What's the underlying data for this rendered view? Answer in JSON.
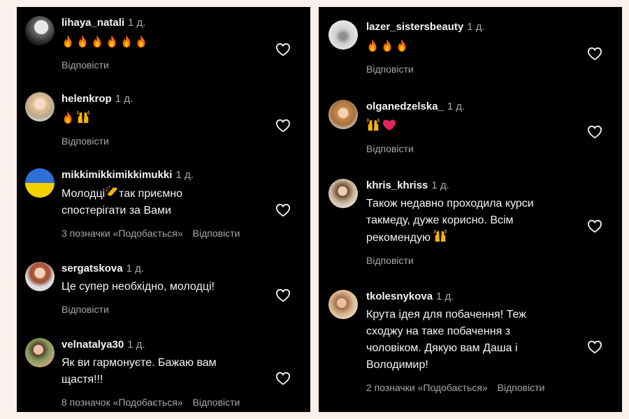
{
  "left_panel": {
    "comments": [
      {
        "username": "lihaya_natali",
        "time": "1 д.",
        "text": "",
        "emoji": [
          "fire",
          "fire",
          "fire",
          "fire",
          "fire",
          "fire"
        ],
        "likes": "",
        "reply": "Відповісти"
      },
      {
        "username": "helenkrop",
        "time": "1 д.",
        "text": "",
        "emoji": [
          "fire",
          "raised-hands"
        ],
        "likes": "",
        "reply": "Відповісти"
      },
      {
        "username": "mikkimikkimikkimukki",
        "time": "1 д.",
        "text_line1": "Молодці",
        "text_line1_rest": "так приємно",
        "text_line2": "спостерігати за Вами",
        "emoji": [
          "clap"
        ],
        "likes": "3 позначки «Подобається»",
        "reply": "Відповісти"
      },
      {
        "username": "sergatskova",
        "time": "1 д.",
        "text": "Це супер необхідно, молодці!",
        "likes": "",
        "reply": "Відповісти"
      },
      {
        "username": "velnatalya30",
        "time": "1 д.",
        "text_line1": "Як ви гармонуєте. Бажаю вам",
        "text_line2": "щастя!!!",
        "likes": "8 позначок «Подобається»",
        "reply": "Відповісти"
      }
    ]
  },
  "right_panel": {
    "comments": [
      {
        "username": "lazer_sistersbeauty",
        "time": "1 д.",
        "emoji": [
          "fire",
          "fire",
          "fire"
        ],
        "likes": "",
        "reply": "Відповісти"
      },
      {
        "username": "olganedzelska_",
        "time": "1 д.",
        "emoji": [
          "raised-hands",
          "red-heart"
        ],
        "likes": "",
        "reply": "Відповісти"
      },
      {
        "username": "khris_khriss",
        "time": "1 д.",
        "text_line1": "Також недавно проходила курси",
        "text_line2": "такмеду, дуже корисно. Всім",
        "text_line3": "рекомендую",
        "emoji": [
          "raised-hands"
        ],
        "likes": "",
        "reply": "Відповісти"
      },
      {
        "username": "tkolesnykova",
        "time": "1 д.",
        "text_line1": "Крута ідея для побачення! Теж",
        "text_line2": "сходжу на таке побачення з",
        "text_line3": "чоловіком. Дякую вам Даша і",
        "text_line4": "Володимир!",
        "likes": "2 позначки «Подобається»",
        "reply": "Відповісти"
      }
    ]
  },
  "colors": {
    "panel_bg": "#000000",
    "text": "#f5f5f5",
    "muted": "#a8a8a8",
    "page_bg": "#fbf0ec",
    "heart_red": "#e0245e",
    "fire": "#ff7a1a"
  },
  "icons": {
    "like": "heart-outline-icon"
  }
}
